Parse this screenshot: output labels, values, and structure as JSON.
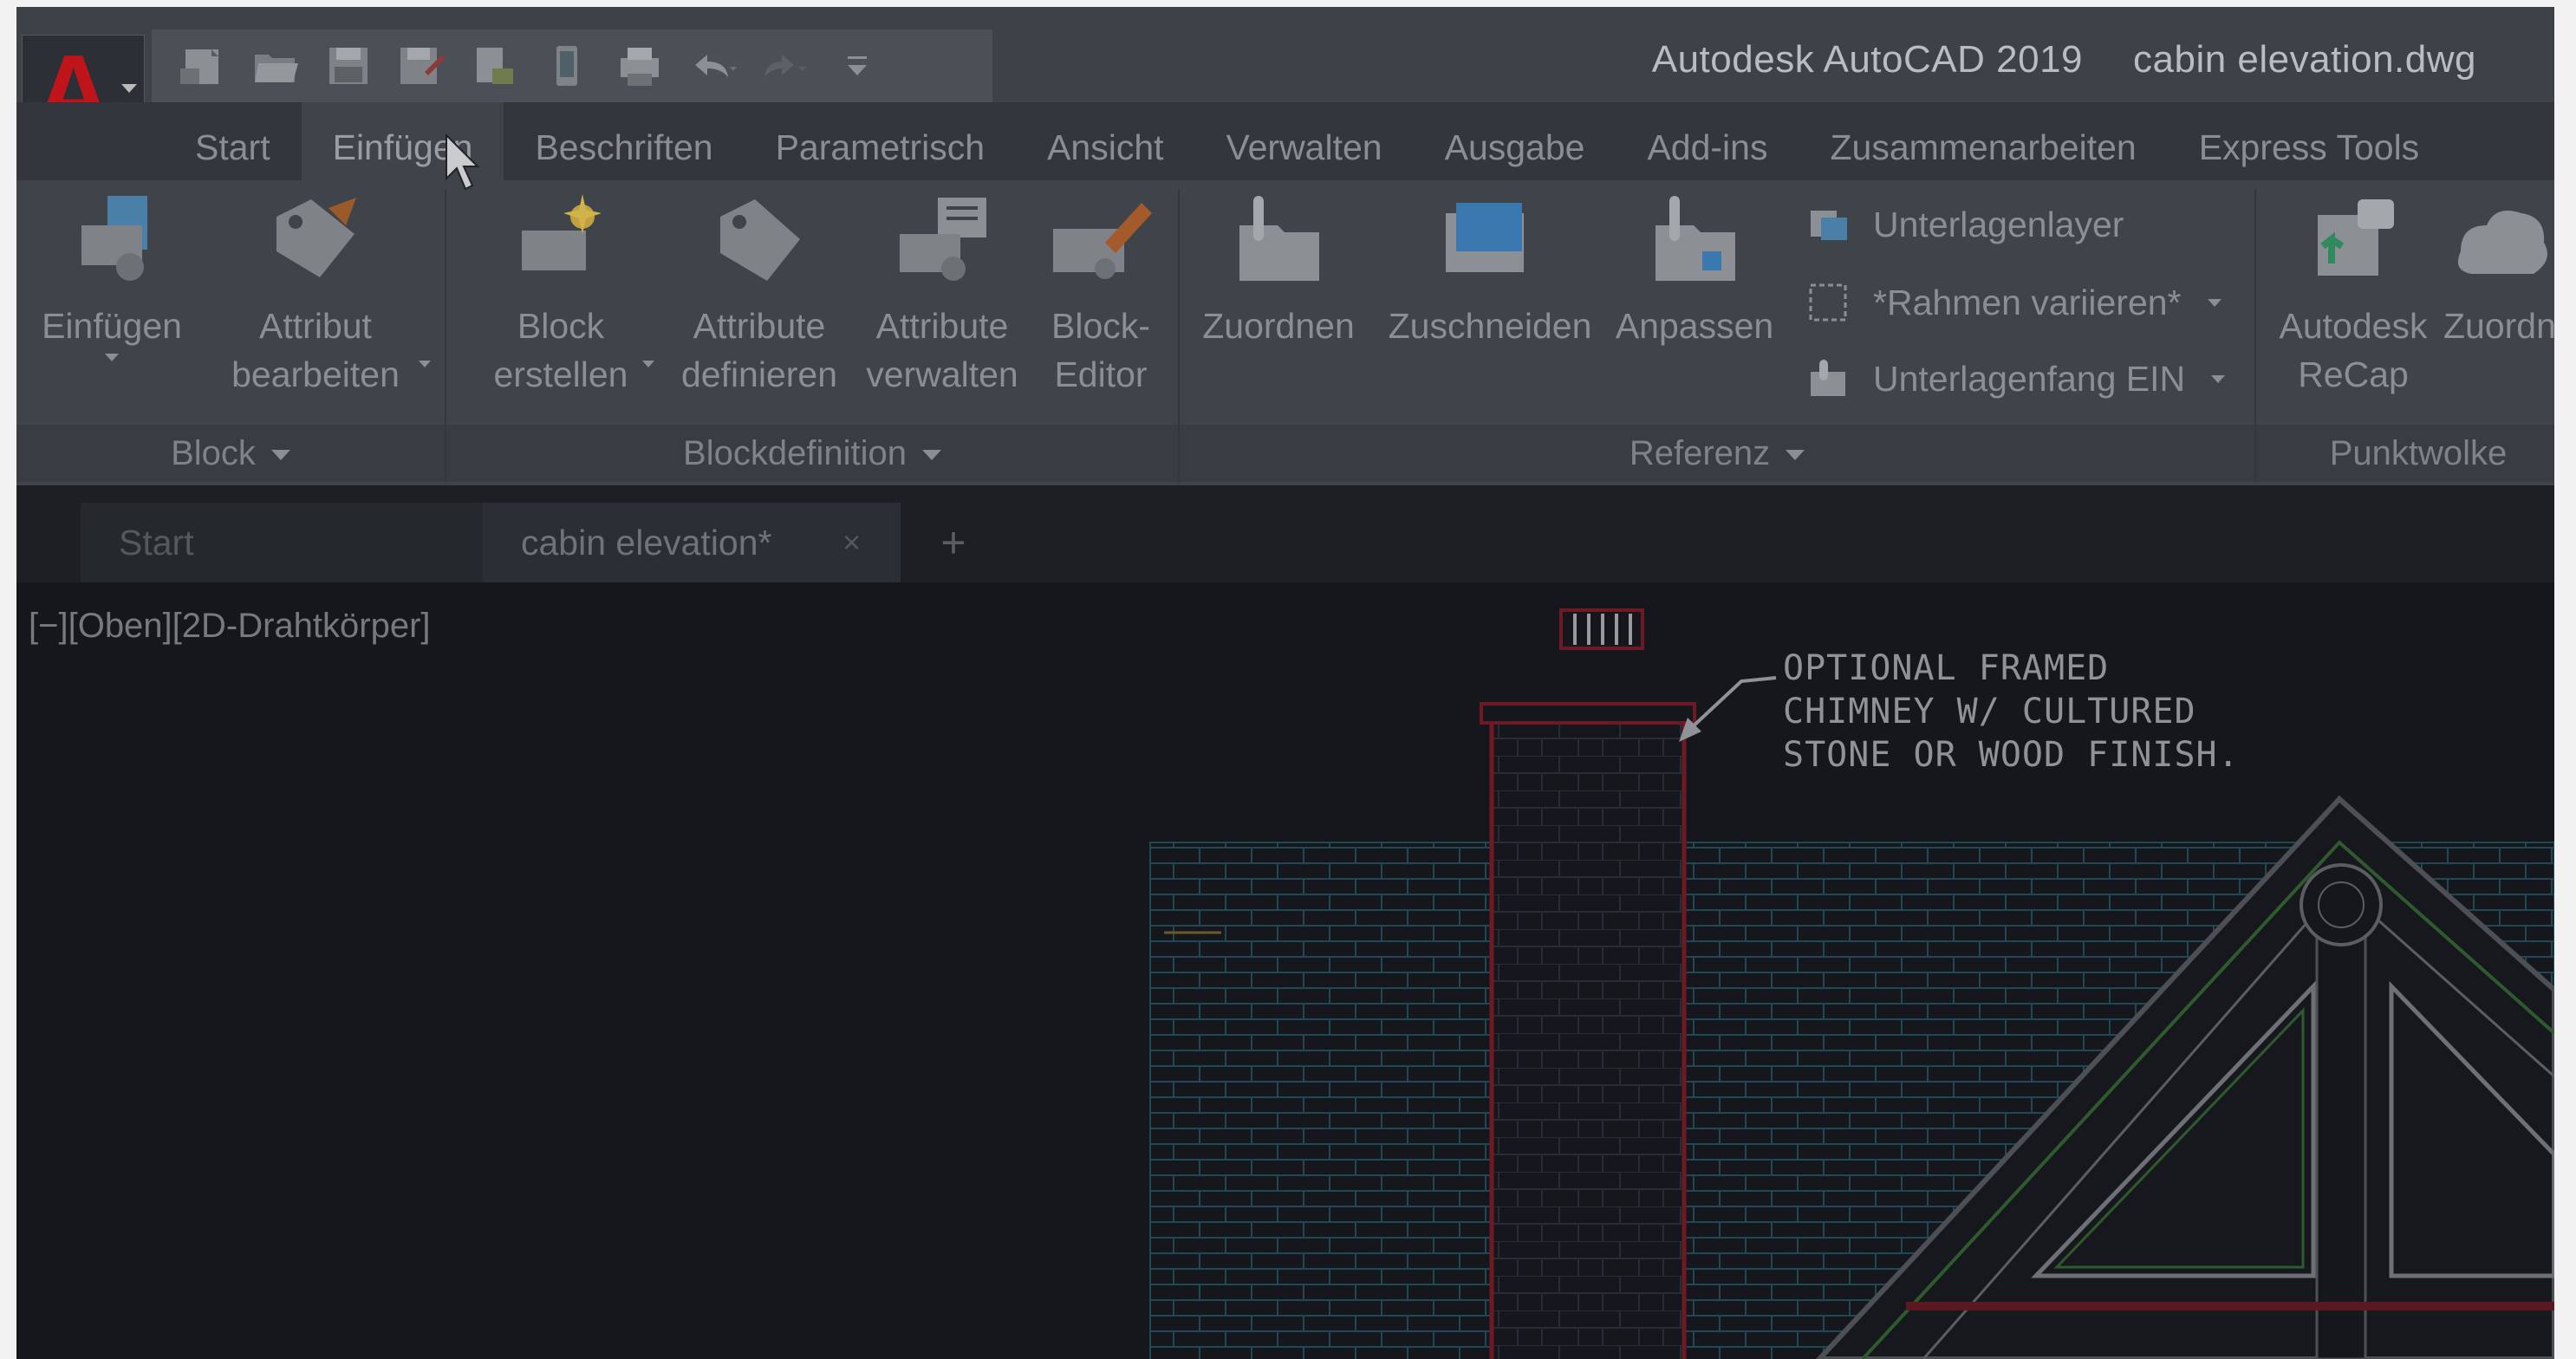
{
  "window": {
    "app_name": "Autodesk AutoCAD 2019",
    "file_name": "cabin elevation.dwg"
  },
  "app_button": {
    "letter": "A",
    "icon": "autocad-logo-icon"
  },
  "quick_access_toolbar": [
    {
      "name": "new-icon"
    },
    {
      "name": "open-icon"
    },
    {
      "name": "save-icon"
    },
    {
      "name": "save-as-icon"
    },
    {
      "name": "open-from-web-icon"
    },
    {
      "name": "save-to-mobile-icon"
    },
    {
      "name": "plot-icon"
    },
    {
      "name": "undo-icon"
    },
    {
      "name": "redo-icon"
    },
    {
      "name": "customize-qat-icon"
    }
  ],
  "ribbon_tabs": [
    {
      "label": "Start",
      "active": false
    },
    {
      "label": "Einfügen",
      "active": true
    },
    {
      "label": "Beschriften",
      "active": false
    },
    {
      "label": "Parametrisch",
      "active": false
    },
    {
      "label": "Ansicht",
      "active": false
    },
    {
      "label": "Verwalten",
      "active": false
    },
    {
      "label": "Ausgabe",
      "active": false
    },
    {
      "label": "Add-ins",
      "active": false
    },
    {
      "label": "Zusammenarbeiten",
      "active": false
    },
    {
      "label": "Express Tools",
      "active": false
    }
  ],
  "ribbon": {
    "block_panel": {
      "title": "Block",
      "insert": {
        "line1": "Einfügen"
      },
      "edit_attribute": {
        "line1": "Attribut",
        "line2": "bearbeiten"
      }
    },
    "blockdef_panel": {
      "title": "Blockdefinition",
      "create_block": {
        "line1": "Block",
        "line2": "erstellen"
      },
      "define_attributes": {
        "line1": "Attribute",
        "line2": "definieren"
      },
      "manage_attributes": {
        "line1": "Attribute",
        "line2": "verwalten"
      },
      "block_editor": {
        "line1": "Block-",
        "line2": "Editor"
      }
    },
    "reference_panel": {
      "title": "Referenz",
      "attach": "Zuordnen",
      "clip": "Zuschneiden",
      "adjust": "Anpassen",
      "underlay_layers": "Unterlagenlayer",
      "vary_frames": "*Rahmen variieren*",
      "underlay_snap": "Unterlagenfang EIN"
    },
    "pointcloud_panel": {
      "title": "Punktwolke",
      "recap": {
        "line1": "Autodesk",
        "line2": "ReCap"
      },
      "attach": "Zuordn"
    }
  },
  "doc_tabs": {
    "start": "Start",
    "active": "cabin elevation*",
    "close": "×",
    "new": "+"
  },
  "viewport": {
    "label": "[−][Oben][2D-Drahtkörper]"
  },
  "drawing": {
    "annotation": [
      "OPTIONAL FRAMED",
      "CHIMNEY W/ CULTURED",
      "STONE OR WOOD FINISH."
    ],
    "colors": {
      "chimney": "#6e1a24",
      "brick": "#1d4450",
      "trim": "#2f5a2e",
      "roof": "#5a5e63",
      "background": "#15171c"
    }
  }
}
